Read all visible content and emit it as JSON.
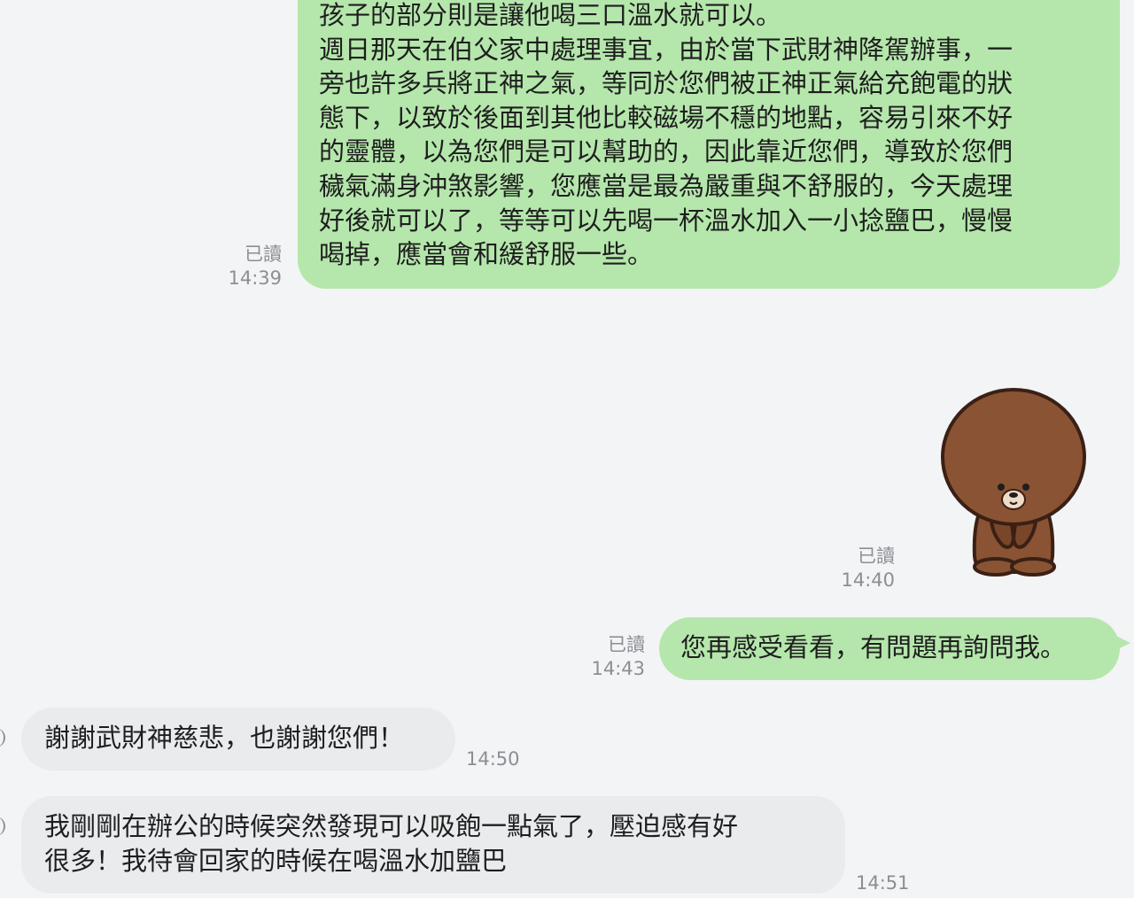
{
  "messages": {
    "msg1": {
      "lines": [
        "孩子的部分則是讓他喝三口溫水就可以。",
        "週日那天在伯父家中處理事宜，由於當下武財神降駕辦事，一",
        "旁也許多兵將正神之氣，等同於您們被正神正氣給充飽電的狀",
        "態下，以致於後面到其他比較磁場不穩的地點，容易引來不好",
        "的靈體，以為您們是可以幫助的，因此靠近您們，導致於您們",
        "穢氣滿身沖煞影響，您應當是最為嚴重與不舒服的，今天處理",
        "好後就可以了，等等可以先喝一杯溫水加入一小捻鹽巴，慢慢",
        "喝掉，應當會和緩舒服一些。"
      ],
      "read": "已讀",
      "time": "14:39"
    },
    "sticker": {
      "icon": "brown-bear-bow-sticker",
      "read": "已讀",
      "time": "14:40"
    },
    "msg3": {
      "text": "您再感受看看，有問題再詢問我。",
      "read": "已讀",
      "time": "14:43"
    },
    "msg4": {
      "text": "謝謝武財神慈悲，也謝謝您們！",
      "time": "14:50"
    },
    "msg5": {
      "lines": [
        "我剛剛在辦公的時候突然發現可以吸飽一點氣了，壓迫感有好",
        "很多！我待會回家的時候在喝溫水加鹽巴"
      ],
      "time": "14:51"
    }
  },
  "colors": {
    "background": "#f3f4f6",
    "outgoing_bubble": "#b5e7ac",
    "incoming_bubble": "#e9ebed",
    "meta_text": "#8b8f94",
    "bear_brown": "#8a5333",
    "bear_dark": "#5a3020"
  }
}
